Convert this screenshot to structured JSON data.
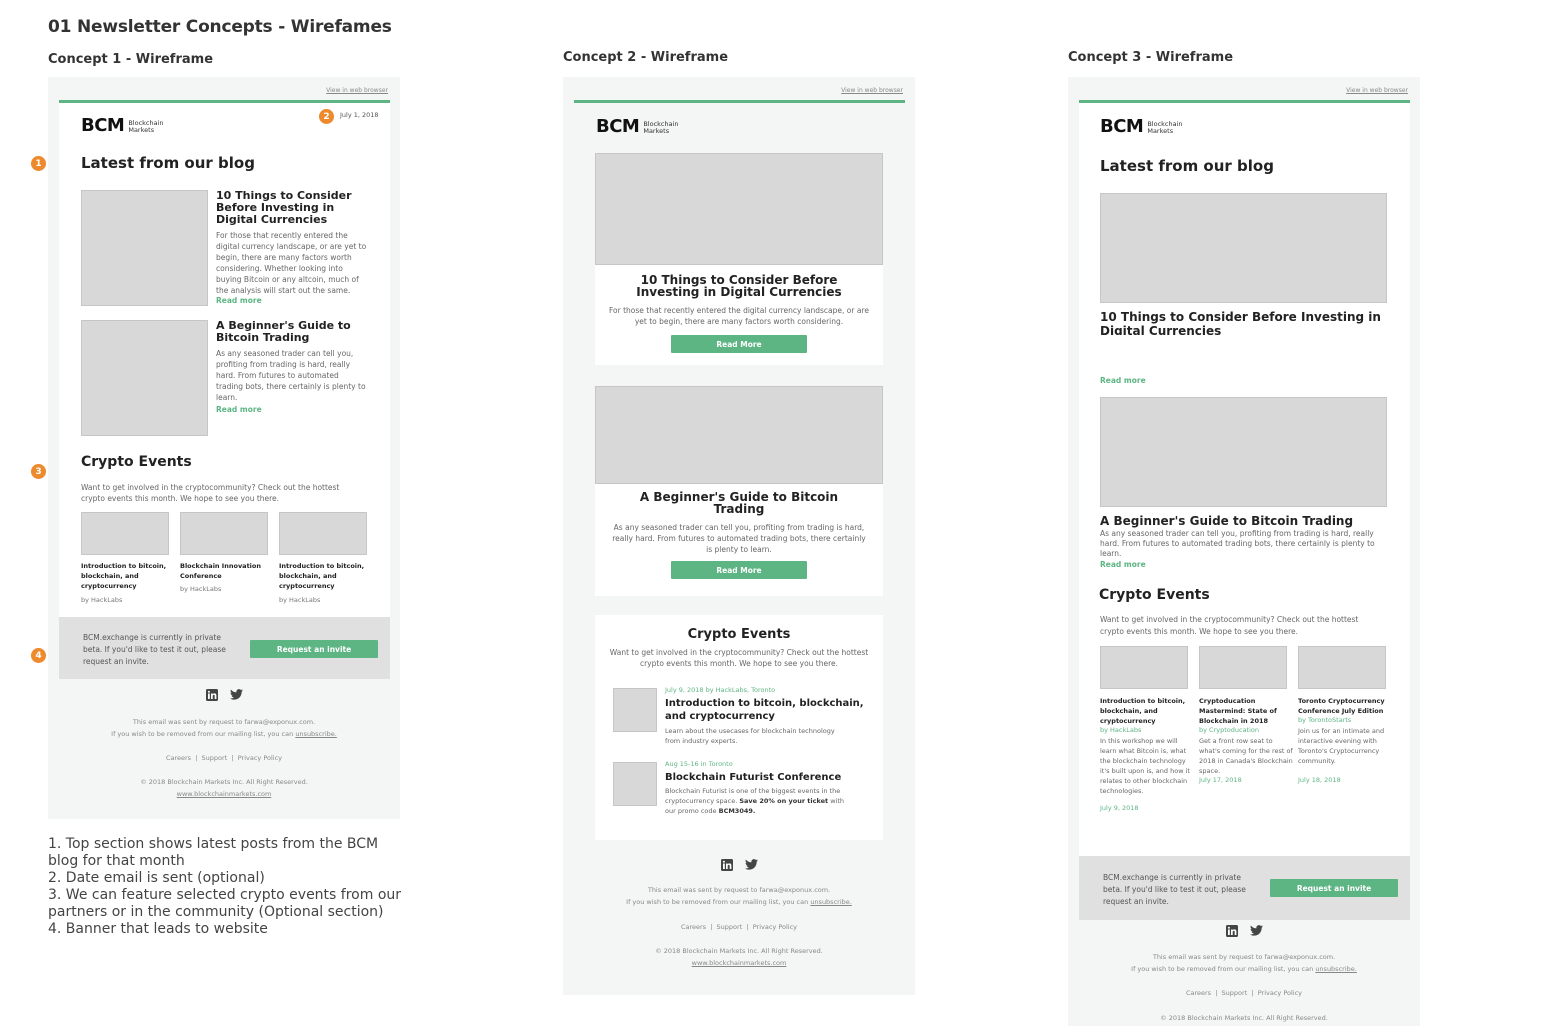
{
  "page": {
    "title": "01 Newsletter Concepts - Wirefames",
    "notes": [
      "1. Top section shows latest posts from the BCM",
      "blog for that month",
      "2. Date email is sent (optional)",
      "3. We can feature selected crypto events from our",
      "partners or in the community (Optional section)",
      "4. Banner that leads to website"
    ]
  },
  "shared": {
    "view_in_browser": "View in web browser",
    "logo_big": "BCM",
    "logo_small_1": "Blockchain",
    "logo_small_2": "Markets",
    "date": "July 1, 2018",
    "blog_heading": "Latest from our blog",
    "post1_title": "10 Things to Consider Before Investing in Digital Currencies",
    "post1_body": "For those that recently entered the digital currency landscape, or are yet to begin, there are many factors worth considering. Whether looking into buying Bitcoin or any altcoin, much of the analysis will start out the same.",
    "post1_body_short": "For those that recently entered the digital currency landscape, or are yet to begin, there are many factors worth considering.",
    "post1_title_c3": "10 Things to Consider Before Investing in Digital Currencies",
    "post2_title": "A Beginner's Guide to Bitcoin Trading",
    "post2_body_c1": "As any seasoned trader can tell you, profiting from trading is hard, really hard. From futures to automated trading bots, there certainly is plenty to learn.",
    "post2_body": "As any seasoned trader can tell you, profiting from trading is hard, really hard. From futures to automated trading bots, there certainly is plenty to learn.",
    "read_more": "Read more",
    "read_more_btn": "Read More",
    "events_heading": "Crypto Events",
    "events_intro": "Want to get involved in the cryptocommunity? Check out the hottest crypto events this month. We hope to see you there.",
    "banner_text": "BCM.exchange is currently in private beta. If you'd like to test it out, please request an invite.",
    "banner_button": "Request an invite",
    "footer_sent": "This email was sent by request to farwa@exponux.com.",
    "footer_remove": "If you wish to be removed from our mailing list, you can",
    "footer_unsub": "unsubscribe.",
    "footer_careers": "Careers",
    "footer_support": "Support",
    "footer_privacy": "Privacy Policy",
    "footer_sep": "|",
    "footer_copyright": "© 2018 Blockchain Markets Inc. All Right Reserved.",
    "footer_site": "www.blockchainmarkets.com",
    "icons": [
      "linkedin-icon",
      "twitter-icon"
    ]
  },
  "concept1": {
    "title": "Concept 1 - Wireframe",
    "markers": [
      "1",
      "2",
      "3",
      "4"
    ],
    "events": [
      {
        "title": "Introduction to bitcoin, blockchain, and cryptocurrency",
        "by": "by HackLabs"
      },
      {
        "title": "Blockchain Innovation Conference",
        "by": "by HackLabs"
      },
      {
        "title": "Introduction to bitcoin, blockchain, and cryptocurrency",
        "by": "by HackLabs"
      }
    ]
  },
  "concept2": {
    "title": "Concept 2 - Wireframe",
    "events": [
      {
        "meta": "July 9, 2018 by HackLabs, Toronto",
        "title": "Introduction to bitcoin, blockchain, and cryptocurrency",
        "desc": "Learn about the usecases for blockchain technology from industry experts."
      },
      {
        "meta": "Aug 15-16 in Toronto",
        "title": "Blockchain Futurist Conference",
        "desc_a": "Blockchain Futurist is one of the biggest events in the cryptocurrency space.",
        "desc_b": "Save 20% on your ticket",
        "desc_c": "with our promo code",
        "desc_d": "BCM3049."
      }
    ]
  },
  "concept3": {
    "title": "Concept 3 - Wireframe",
    "events": [
      {
        "title": "Introduction to bitcoin, blockchain, and cryptocurrency",
        "by": "by HackLabs",
        "desc": "In this workshop we will learn what Bitcoin is, what the blockchain technology it's built upon is, and how it relates to other blockchain technologies.",
        "date": "July 9, 2018"
      },
      {
        "title": "Cryptoducation Mastermind: State of Blockchain in 2018",
        "by": "by Cryptoducation",
        "desc": "Get a front row seat to what's coming for the rest of 2018 in Canada's Blockchain space.",
        "date": "July 17, 2018"
      },
      {
        "title": "Toronto Cryptocurrency Conference July Edition",
        "by": "by TorontoStarts",
        "desc": "Join us for an intimate and interactive evening with Toronto's Cryptocurrency community.",
        "date": "July 18, 2018"
      }
    ]
  }
}
